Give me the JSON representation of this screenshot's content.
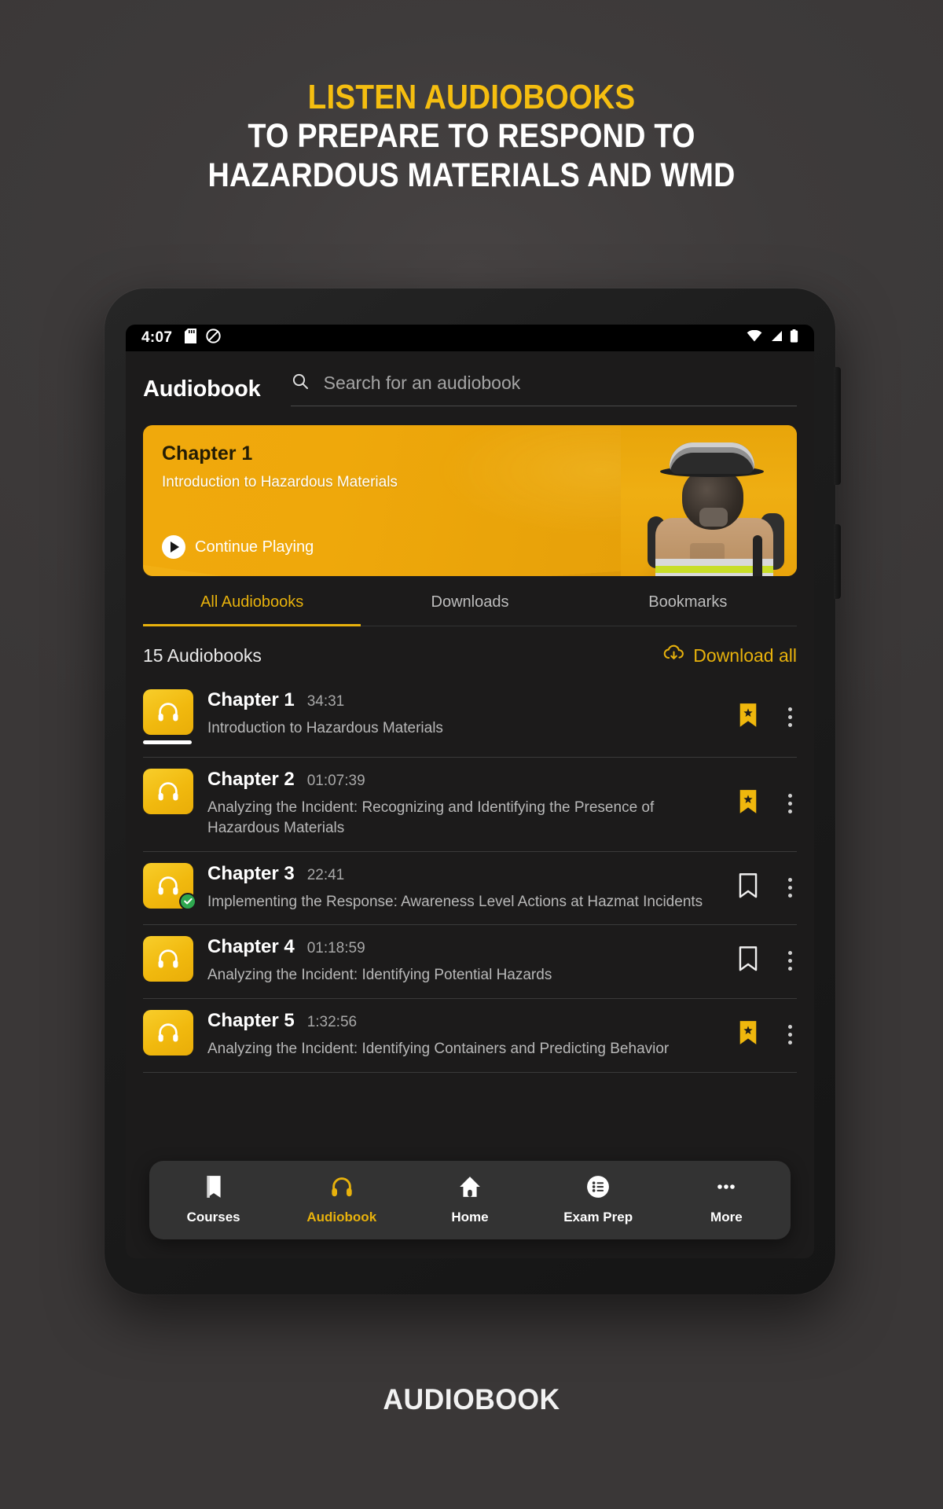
{
  "promo": {
    "line1": "LISTEN AUDIOBOOKS",
    "line2": "TO PREPARE TO RESPOND TO",
    "line3": "HAZARDOUS MATERIALS AND WMD",
    "accent_color": "#F5BE10"
  },
  "caption": "AUDIOBOOK",
  "status_bar": {
    "time": "4:07",
    "left_icons": [
      "sd-card-icon",
      "do-not-disturb-icon"
    ],
    "right_icons": [
      "wifi-icon",
      "signal-icon",
      "battery-icon"
    ]
  },
  "header": {
    "title": "Audiobook",
    "search_placeholder": "Search for an audiobook",
    "search_value": "",
    "search_icon": "search-icon"
  },
  "hero": {
    "chapter": "Chapter 1",
    "subtitle": "Introduction to Hazardous Materials",
    "cta_label": "Continue Playing",
    "play_icon": "play-icon",
    "bg_color": "#EFA80B",
    "image_alt": "firefighter-in-turnout-gear-with-scba"
  },
  "tabs": [
    {
      "label": "All Audiobooks",
      "active": true
    },
    {
      "label": "Downloads",
      "active": false
    },
    {
      "label": "Bookmarks",
      "active": false
    }
  ],
  "list_header": {
    "count_label": "15 Audiobooks",
    "download_all_label": "Download all",
    "download_all_icon": "cloud-download-icon",
    "accent_color": "#E8B20C"
  },
  "chapters": [
    {
      "title": "Chapter 1",
      "duration": "34:31",
      "description": "Introduction to Hazardous Materials",
      "bookmarked": true,
      "downloaded": false,
      "progress_percent": 100,
      "thumb_icon": "headphones-icon",
      "menu_icon": "kebab-menu-icon"
    },
    {
      "title": "Chapter 2",
      "duration": "01:07:39",
      "description": "Analyzing the Incident: Recognizing and Identifying the Presence of Hazardous Materials",
      "bookmarked": true,
      "downloaded": false,
      "progress_percent": 0,
      "thumb_icon": "headphones-icon",
      "menu_icon": "kebab-menu-icon"
    },
    {
      "title": "Chapter 3",
      "duration": "22:41",
      "description": "Implementing the Response: Awareness Level Actions at Hazmat Incidents",
      "bookmarked": false,
      "downloaded": true,
      "progress_percent": 0,
      "thumb_icon": "headphones-icon",
      "menu_icon": "kebab-menu-icon"
    },
    {
      "title": "Chapter 4",
      "duration": "01:18:59",
      "description": "Analyzing the Incident: Identifying Potential Hazards",
      "bookmarked": false,
      "downloaded": false,
      "progress_percent": 0,
      "thumb_icon": "headphones-icon",
      "menu_icon": "kebab-menu-icon"
    },
    {
      "title": "Chapter 5",
      "duration": "1:32:56",
      "description": "Analyzing the Incident: Identifying Containers and Predicting Behavior",
      "bookmarked": true,
      "downloaded": false,
      "progress_percent": 0,
      "thumb_icon": "headphones-icon",
      "menu_icon": "kebab-menu-icon"
    }
  ],
  "bottom_nav": [
    {
      "label": "Courses",
      "icon": "book-icon",
      "active": false
    },
    {
      "label": "Audiobook",
      "icon": "headphones-icon",
      "active": true
    },
    {
      "label": "Home",
      "icon": "home-icon",
      "active": false
    },
    {
      "label": "Exam Prep",
      "icon": "list-circle-icon",
      "active": false
    },
    {
      "label": "More",
      "icon": "more-dots-icon",
      "active": false
    }
  ]
}
